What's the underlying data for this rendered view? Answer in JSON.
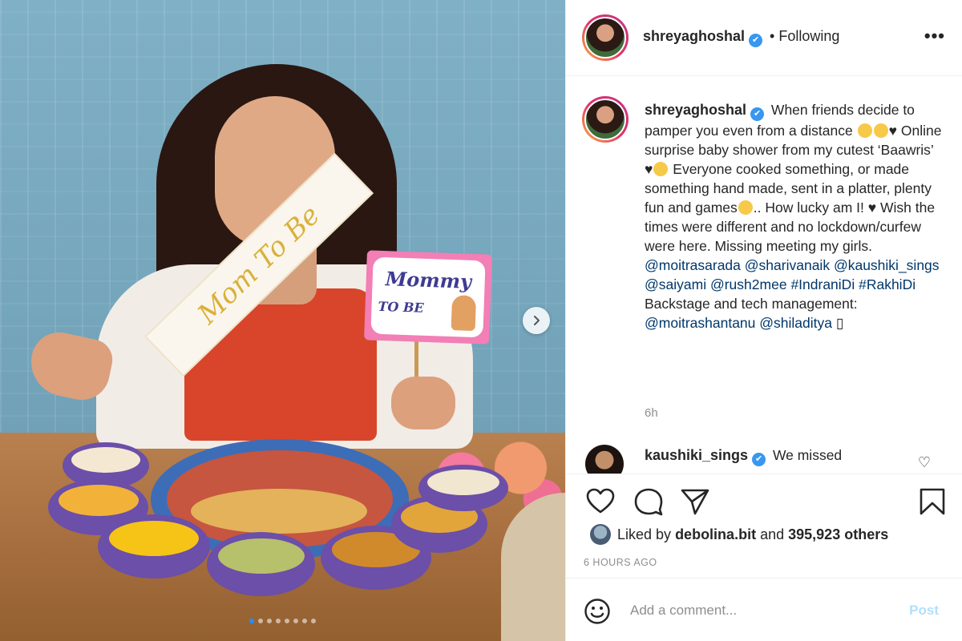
{
  "post": {
    "username": "shreyaghoshal",
    "follow_status": "Following",
    "more_icon": "•••",
    "photo": {
      "sign_line1": "Mommy",
      "sign_line2": "TO BE",
      "sash_text": "Mom To Be",
      "carousel_dots": 8,
      "active_dot": 0
    },
    "caption": {
      "username": "shreyaghoshal",
      "p1": "When friends decide to pamper you even from a distance",
      "p2": "Online surprise baby shower from my cutest ‘Baawris’",
      "p3": "Everyone cooked something, or made something hand made, sent in a platter, plenty fun and games",
      "p4": ".. How lucky am I!",
      "p5": "Wish the times were different and no lockdown/curfew were here. Missing meeting my girls.",
      "mentions": [
        "@moitrasarada",
        "@sharivanaik",
        "@kaushiki_sings",
        "@saiyami",
        "@rush2mee",
        "#IndraniDi",
        "#RakhiDi"
      ],
      "p6": "Backstage and tech management:",
      "mentions2": [
        "@moitrashantanu",
        "@shiladitya"
      ],
      "end_glyph": "▯",
      "time": "6h"
    },
    "comment": {
      "username": "kaushiki_sings",
      "text": "We missed"
    },
    "likes": {
      "prefix": "Liked by",
      "liker": "debolina.bit",
      "middle": "and",
      "count": "395,923 others"
    },
    "timestamp": "6 HOURS AGO",
    "add_comment": {
      "placeholder": "Add a comment...",
      "post_label": "Post"
    }
  },
  "colors": {
    "link": "#00376b",
    "verified": "#3897f0",
    "muted": "#8e8e8e",
    "post_disabled": "#b2dffc",
    "carousel_active": "#1e90ff"
  }
}
